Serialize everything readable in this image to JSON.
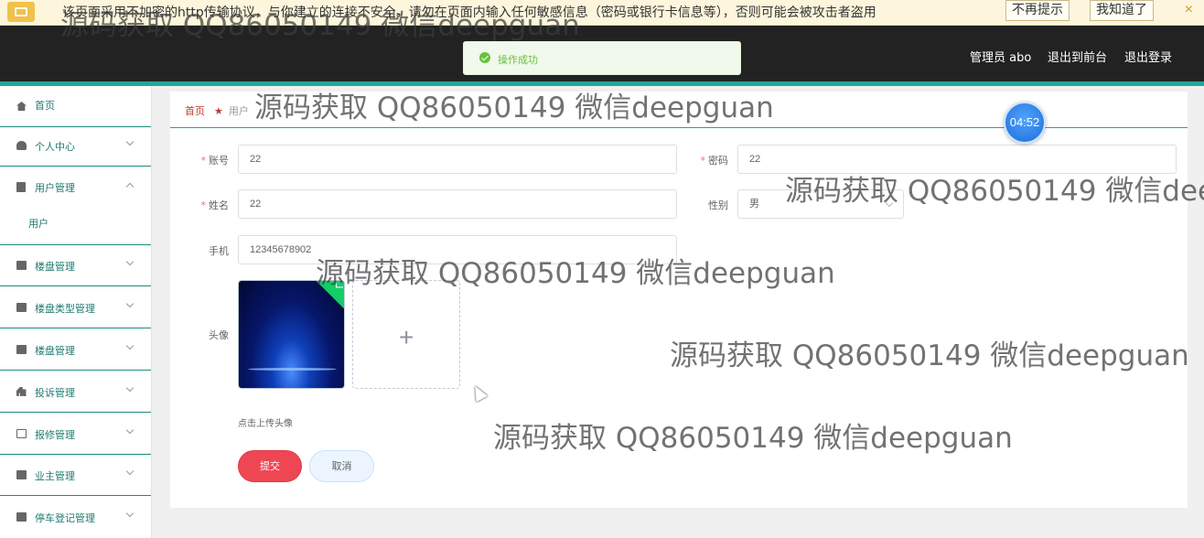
{
  "warning": {
    "text": "该页面采用不加密的http传输协议，与你建立的连接不安全，请勿在页面内输入任何敏感信息（密码或银行卡信息等），否则可能会被攻击者盗用",
    "dont_remind": "不再提示",
    "got_it": "我知道了",
    "close": "×"
  },
  "toast": {
    "message": "操作成功"
  },
  "header": {
    "admin": "管理员 abo",
    "to_front": "退出到前台",
    "logout": "退出登录"
  },
  "sidebar": {
    "items": [
      {
        "label": "首页"
      },
      {
        "label": "个人中心"
      },
      {
        "label": "用户管理"
      },
      {
        "label": "用户"
      },
      {
        "label": "楼盘管理"
      },
      {
        "label": "楼盘类型管理"
      },
      {
        "label": "楼盘管理"
      },
      {
        "label": "投诉管理"
      },
      {
        "label": "报修管理"
      },
      {
        "label": "业主管理"
      },
      {
        "label": "停车登记管理"
      }
    ]
  },
  "breadcrumb": {
    "home": "首页",
    "current": "用户"
  },
  "timer": "04:52",
  "form": {
    "account": {
      "label": "账号",
      "value": "22"
    },
    "password": {
      "label": "密码",
      "value": "22"
    },
    "name": {
      "label": "姓名",
      "value": "22"
    },
    "gender": {
      "label": "性别",
      "value": "男"
    },
    "phone": {
      "label": "手机",
      "value": "12345678902"
    },
    "avatar": {
      "label": "头像",
      "tip": "点击上传头像"
    },
    "submit": "提交",
    "cancel": "取消"
  },
  "watermark": "源码获取 QQ86050149 微信deepguan"
}
